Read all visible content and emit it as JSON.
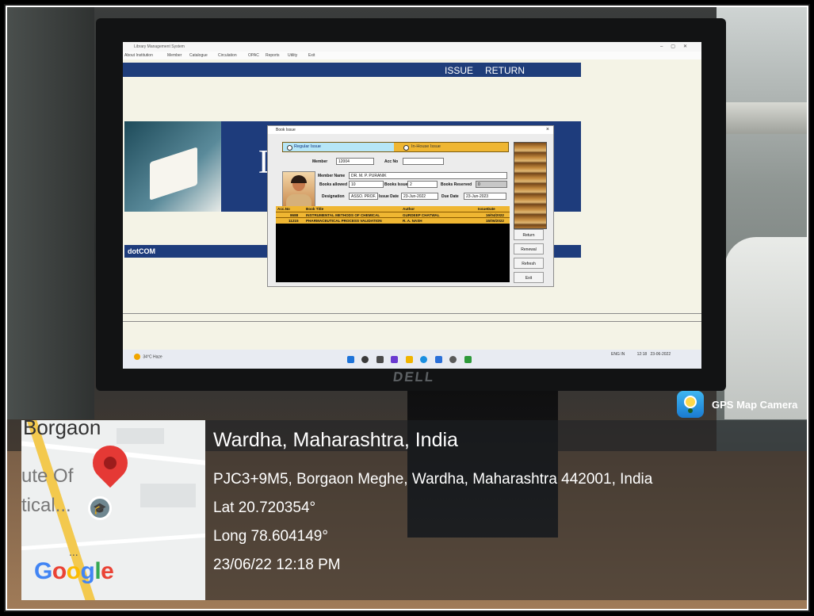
{
  "app": {
    "window_title": "Library Management System",
    "menu": [
      "About Institution",
      "Member",
      "Catalogue",
      "Circulation",
      "OPAC",
      "Reports",
      "Utility",
      "Exit"
    ],
    "top_tabs": [
      "ISSUE",
      "RETURN"
    ],
    "banner_letter": "L",
    "brand": "dotCOM"
  },
  "dialog": {
    "title": "Book Issue",
    "close_glyph": "×",
    "tab_regular": "Regular Issue",
    "tab_inhouse": "In-House Issue",
    "member_label": "Member",
    "member_value": "12004",
    "acc_no_label": "Acc No",
    "acc_no_value": "",
    "member_name_label": "Member Name",
    "member_name_value": "DR. M. P. PURANIK",
    "books_allowed_label": "Books allowed",
    "books_allowed_value": "10",
    "books_issued_label": "Books Issued",
    "books_issued_value": "2",
    "books_reserved_label": "Books Reserved",
    "books_reserved_value": "0",
    "designation_label": "Designation",
    "designation_value": "ASSO. PROF.",
    "issue_date_label": "Issue Date",
    "issue_date_value": "23-Jun-2022",
    "due_date_label": "Due Date",
    "due_date_value": "23-Jun-2023",
    "table": {
      "headers": [
        "Acc.No",
        "Book Title",
        "Author",
        "IssueDate"
      ],
      "rows": [
        [
          "8688",
          "INSTRUMENTAL METHODS OF CHEMICAL",
          "GURDEEP CHATWAL",
          "16/04/2022"
        ],
        [
          "11215",
          "PHARMACEUTICAL PROCESS VALIDATION",
          "R. A. NASH",
          "15/06/2022"
        ]
      ]
    },
    "buttons": [
      "Return",
      "Renewal",
      "Refresh",
      "Exit"
    ]
  },
  "taskbar": {
    "weather_temp": "34°C",
    "weather_desc": "Haze",
    "tray_lang": "ENG IN",
    "tray_time": "12:18",
    "tray_date": "23-06-2022"
  },
  "monitor_brand": "DELL",
  "gps": {
    "app_name": "GPS Map Camera",
    "location": "Wardha, Maharashtra, India",
    "address": "PJC3+9M5, Borgaon Meghe, Wardha, Maharashtra 442001, India",
    "lat": "Lat 20.720354°",
    "long": "Long 78.604149°",
    "datetime": "23/06/22 12:18 PM"
  },
  "map": {
    "town": "Borgaon",
    "place_line1": "ute Of",
    "place_line2": "tical...",
    "dots": "...",
    "provider_letters": [
      "G",
      "o",
      "o",
      "g",
      "l",
      "e"
    ],
    "provider_colors": [
      "#4285F4",
      "#EA4335",
      "#FBBC05",
      "#4285F4",
      "#34A853",
      "#EA4335"
    ]
  }
}
